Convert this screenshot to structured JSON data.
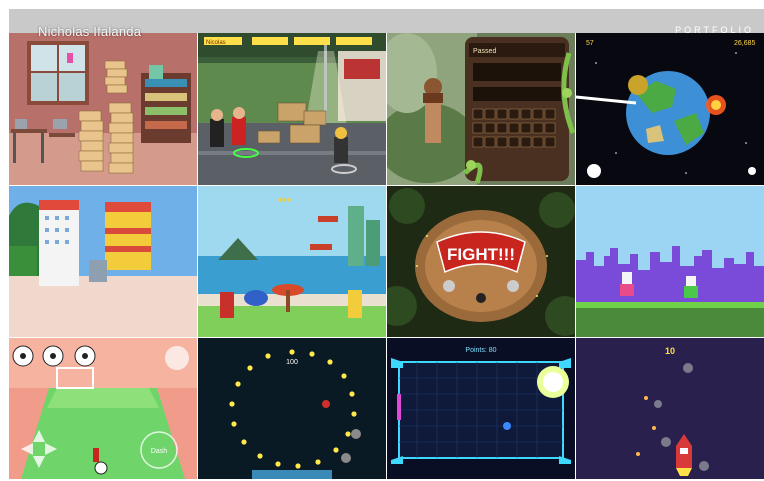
{
  "header": {
    "site_title": "Nicholas Ifalanda",
    "nav_link": "PORTFOLIO"
  },
  "tiles": [
    {
      "scene": "classroom-with-stacked-boxes"
    },
    {
      "scene": "street-brawler-fight",
      "hud": "Nicolas"
    },
    {
      "scene": "jungle-word-puzzle",
      "hud": "Passed"
    },
    {
      "scene": "low-poly-planet-in-space",
      "hud_left": "57",
      "hud_right": "26,685"
    },
    {
      "scene": "3d-town-with-round-towers"
    },
    {
      "scene": "beach-arcade-level"
    },
    {
      "scene": "arena-fight-start",
      "banner": "FIGHT!!!"
    },
    {
      "scene": "pixel-city-skyline-runner"
    },
    {
      "scene": "soccer-goal-mobile-game",
      "button": "Dash"
    },
    {
      "scene": "circle-of-lights-space",
      "hud": "100"
    },
    {
      "scene": "neon-hexagon-arena",
      "hud": "Points: 80"
    },
    {
      "scene": "rocket-asteroid-shooter",
      "hud": "10"
    }
  ],
  "colors": {
    "header_bar": "#c9c9c9",
    "neon_cyan": "#3fd8ff",
    "fight_red": "#c8251e"
  }
}
